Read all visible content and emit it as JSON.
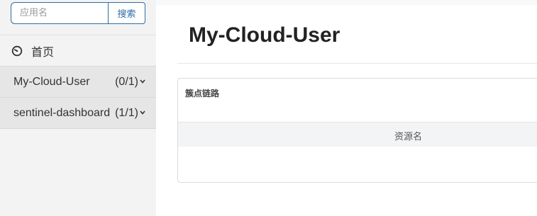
{
  "sidebar": {
    "search": {
      "placeholder": "应用名",
      "button_label": "搜索"
    },
    "home": {
      "label": "首页",
      "icon": "dashboard-gauge-icon"
    },
    "apps": [
      {
        "name": "My-Cloud-User",
        "count": "(0/1)"
      },
      {
        "name": "sentinel-dashboard",
        "count": "(1/1)"
      }
    ]
  },
  "main": {
    "title": "My-Cloud-User",
    "card": {
      "title": "簇点链路",
      "columns": [
        "资源名"
      ]
    }
  },
  "colors": {
    "accent": "#2e6da4",
    "sidebar_bg": "#f3f3f3",
    "app_item_bg": "#e6e6e6",
    "table_header_bg": "#f3f4f6"
  }
}
